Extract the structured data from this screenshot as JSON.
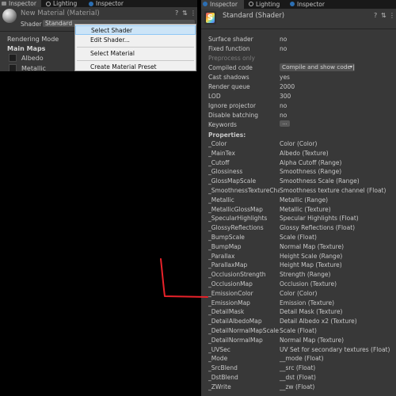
{
  "left_inspector": {
    "tabs": [
      {
        "label": "Inspector",
        "icon": "inspector-icon"
      },
      {
        "label": "Lighting",
        "icon": "lighting-icon"
      },
      {
        "label": "Inspector",
        "icon": "info-icon"
      }
    ],
    "material_name": "New Material (Material)",
    "header_icons": [
      "help-icon",
      "settings-sliders-icon",
      "kebab-menu-icon"
    ],
    "shader_label": "Shader",
    "shader_value": "Standard",
    "rendering_mode_label": "Rendering Mode",
    "main_maps_label": "Main Maps",
    "albedo_label": "Albedo",
    "metallic_label": "Metallic"
  },
  "context_menu": {
    "items": [
      "Select Shader",
      "Edit Shader...",
      "Select Material",
      "Create Material Preset"
    ],
    "highlighted": "Select Shader"
  },
  "right_inspector": {
    "tabs": [
      {
        "label": "Inspector",
        "icon": "info-icon"
      },
      {
        "label": "Lighting",
        "icon": "lighting-icon"
      },
      {
        "label": "Inspector",
        "icon": "info-icon"
      }
    ],
    "title": "Standard (Shader)",
    "header_icons": [
      "help-icon",
      "settings-sliders-icon",
      "kebab-menu-icon"
    ],
    "info": [
      {
        "key": "Surface shader",
        "value": "no"
      },
      {
        "key": "Fixed function",
        "value": "no"
      },
      {
        "key": "Preprocess only",
        "value": ""
      },
      {
        "key": "Compiled code",
        "value": ""
      },
      {
        "key": "Cast shadows",
        "value": "yes"
      },
      {
        "key": "Render queue",
        "value": "2000"
      },
      {
        "key": "LOD",
        "value": "300"
      },
      {
        "key": "Ignore projector",
        "value": "no"
      },
      {
        "key": "Disable batching",
        "value": "no"
      },
      {
        "key": "Keywords",
        "value": ""
      }
    ],
    "compiled_code_dropdown": "Compile and show code |",
    "keywords_button": "...",
    "properties_header": "Properties:",
    "properties": [
      {
        "name": "_Color",
        "desc": "Color (Color)"
      },
      {
        "name": "_MainTex",
        "desc": "Albedo (Texture)"
      },
      {
        "name": "_Cutoff",
        "desc": "Alpha Cutoff (Range)"
      },
      {
        "name": "_Glossiness",
        "desc": "Smoothness (Range)"
      },
      {
        "name": "_GlossMapScale",
        "desc": "Smoothness Scale (Range)"
      },
      {
        "name": "_SmoothnessTextureChannel",
        "desc": "Smoothness texture channel (Float)"
      },
      {
        "name": "_Metallic",
        "desc": "Metallic (Range)"
      },
      {
        "name": "_MetallicGlossMap",
        "desc": "Metallic (Texture)"
      },
      {
        "name": "_SpecularHighlights",
        "desc": "Specular Highlights (Float)"
      },
      {
        "name": "_GlossyReflections",
        "desc": "Glossy Reflections (Float)"
      },
      {
        "name": "_BumpScale",
        "desc": "Scale (Float)"
      },
      {
        "name": "_BumpMap",
        "desc": "Normal Map (Texture)"
      },
      {
        "name": "_Parallax",
        "desc": "Height Scale (Range)"
      },
      {
        "name": "_ParallaxMap",
        "desc": "Height Map (Texture)"
      },
      {
        "name": "_OcclusionStrength",
        "desc": "Strength (Range)"
      },
      {
        "name": "_OcclusionMap",
        "desc": "Occlusion (Texture)"
      },
      {
        "name": "_EmissionColor",
        "desc": "Color (Color)"
      },
      {
        "name": "_EmissionMap",
        "desc": "Emission (Texture)"
      },
      {
        "name": "_DetailMask",
        "desc": "Detail Mask (Texture)"
      },
      {
        "name": "_DetailAlbedoMap",
        "desc": "Detail Albedo x2 (Texture)"
      },
      {
        "name": "_DetailNormalMapScale",
        "desc": "Scale (Float)"
      },
      {
        "name": "_DetailNormalMap",
        "desc": "Normal Map (Texture)"
      },
      {
        "name": "_UVSec",
        "desc": "UV Set for secondary textures (Float)"
      },
      {
        "name": "_Mode",
        "desc": "__mode (Float)"
      },
      {
        "name": "_SrcBlend",
        "desc": "__src (Float)"
      },
      {
        "name": "_DstBlend",
        "desc": "__dst (Float)"
      },
      {
        "name": "_ZWrite",
        "desc": "__zw (Float)"
      }
    ]
  },
  "annotation": {
    "color": "#e8222a",
    "points_to": "_EmissionColor"
  }
}
